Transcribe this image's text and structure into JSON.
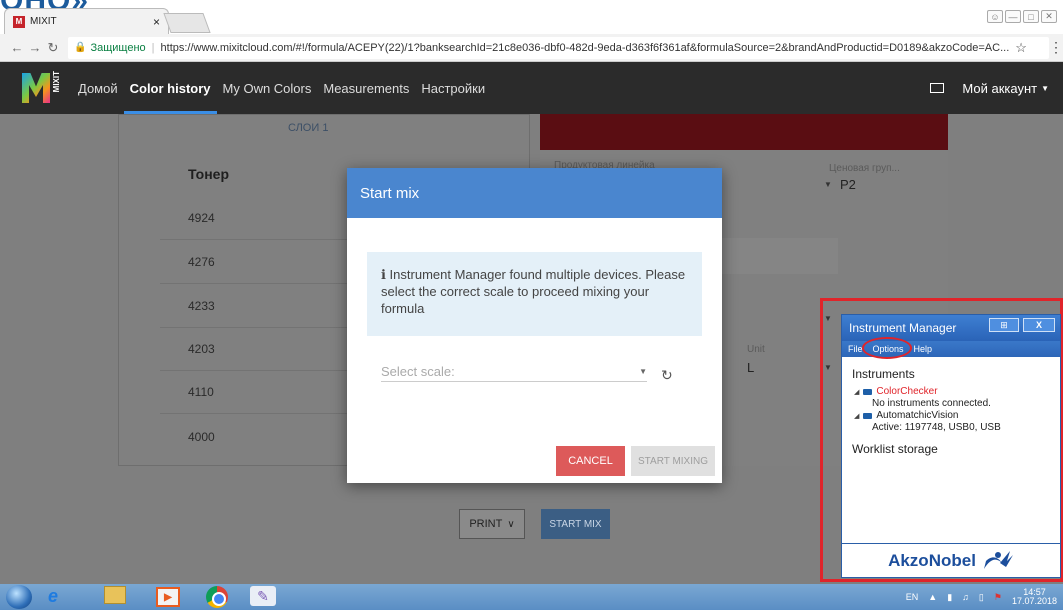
{
  "page_title_fragment": "ОНО»",
  "browser": {
    "tab_title": "MIXIT",
    "tab_close": "×",
    "security_label": "Защищено",
    "url": "https://www.mixitcloud.com/#!/formula/ACEPY(22)/1?banksearchId=21c8e036-dbf0-482d-9eda-d363f6f361af&formulaSource=2&brandAndProductid=D0189&akzoCode=AC..."
  },
  "nav": {
    "logo_text": "MIXIT",
    "items": [
      "Домой",
      "Color history",
      "My Own Colors",
      "Measurements",
      "Настройки"
    ],
    "active_index": 1,
    "account_label": "Мой аккаунт"
  },
  "left_card": {
    "layers_tab": "СЛОИ 1",
    "toner_header": "Тонер",
    "toners": [
      "4924",
      "4276",
      "4233",
      "4203",
      "4110",
      "4000"
    ]
  },
  "right_card": {
    "product_line_label": "Продуктовая линейка",
    "price_group_label": "Ценовая груп...",
    "price_group_value": "P2",
    "unit_label": "Unit",
    "unit_value": "L"
  },
  "actions": {
    "print_label": "PRINT",
    "start_mix_label": "START MIX"
  },
  "modal": {
    "title": "Start mix",
    "info_text": "ℹ Instrument Manager found multiple devices. Please select the correct scale to proceed mixing your formula",
    "select_placeholder": "Select scale:",
    "cancel_label": "CANCEL",
    "start_mixing_label": "START MIXING"
  },
  "instrument_manager": {
    "title": "Instrument Manager",
    "menu": [
      "File",
      "Options",
      "Help"
    ],
    "section_instruments": "Instruments",
    "devices": [
      {
        "name": "ColorChecker",
        "status": "No instruments connected."
      },
      {
        "name": "AutomatchicVision",
        "status": "Active: 1197748, USB0, USB"
      }
    ],
    "section_worklist": "Worklist storage",
    "brand": "AkzoNobel"
  },
  "taskbar": {
    "language": "EN",
    "time": "14:57",
    "date": "17.07.2018"
  },
  "colors": {
    "nav_bg": "#2b2b2b",
    "accent_blue": "#4a86cf",
    "cancel_red": "#dd5a5a",
    "highlight_red": "#e0242a"
  }
}
